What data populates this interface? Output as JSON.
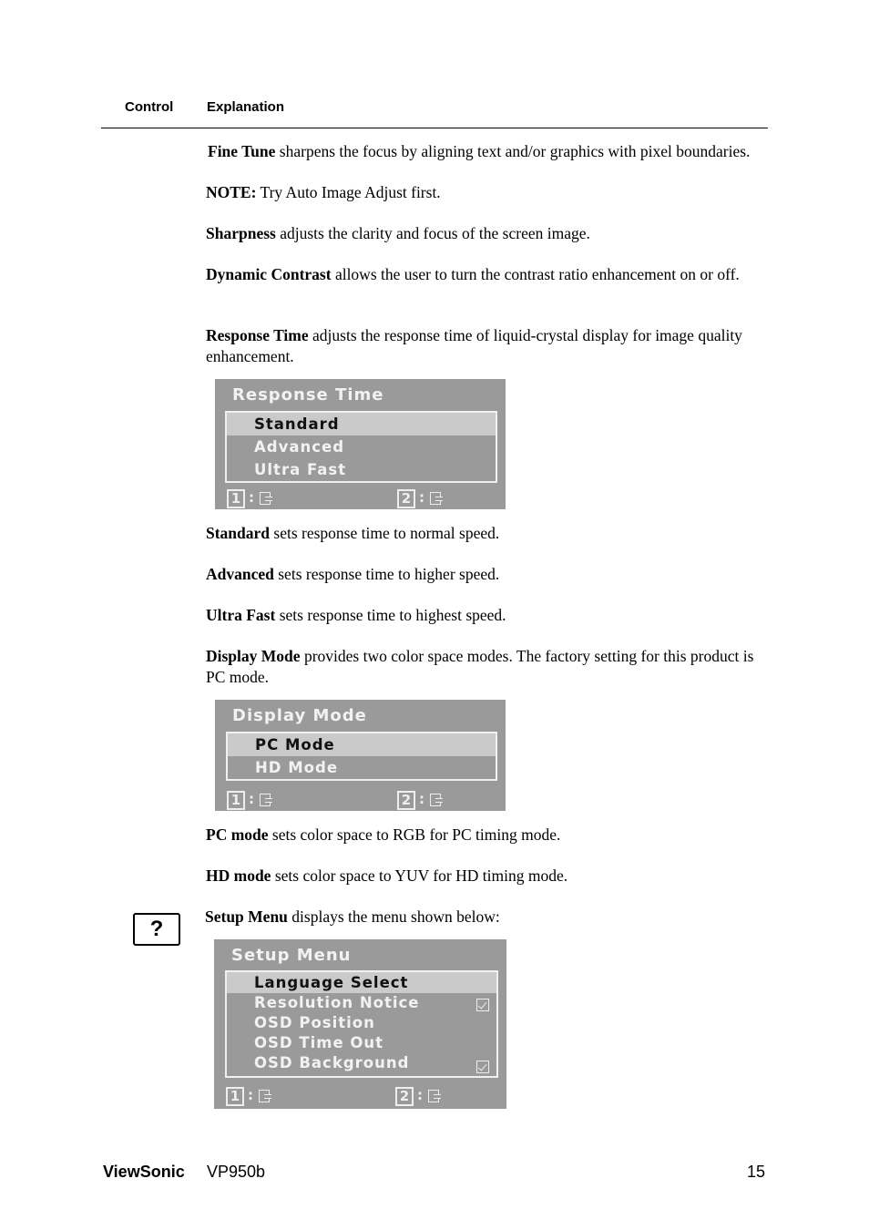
{
  "header": {
    "control": "Control",
    "explanation": "Explanation"
  },
  "paragraphs": {
    "fine_tune": {
      "term": "Fine Tune",
      "text": " sharpens the focus by aligning text and/or graphics with pixel boundaries."
    },
    "note": {
      "term": "NOTE:",
      "text": " Try Auto Image Adjust first."
    },
    "sharpness": {
      "term": "Sharpness",
      "text": " adjusts the clarity and focus of the screen image."
    },
    "dynamic_contrast": {
      "term": "Dynamic Contrast",
      "text": " allows the user to turn the contrast ratio enhancement on or off."
    },
    "response_time": {
      "term": "Response Time",
      "text": " adjusts the response time of liquid-crystal display for image quality enhancement."
    },
    "standard": {
      "term": "Standard",
      "text": " sets response time to normal speed."
    },
    "advanced": {
      "term": "Advanced",
      "text": " sets response time to higher speed."
    },
    "ultra_fast": {
      "term": "Ultra Fast",
      "text": " sets response time to highest speed."
    },
    "display_mode": {
      "term": "Display Mode",
      "text": " provides two color space modes. The factory setting for this product is PC mode."
    },
    "pc_mode": {
      "term": "PC mode",
      "text": " sets color space to RGB for PC timing mode."
    },
    "hd_mode": {
      "term": "HD mode",
      "text": " sets color space to YUV for HD timing mode."
    },
    "setup_menu": {
      "term": "Setup Menu",
      "text": " displays the menu shown below:"
    }
  },
  "osd_response_time": {
    "title": "Response Time",
    "items": [
      "Standard",
      "Advanced",
      "Ultra Fast"
    ],
    "selected": "Standard",
    "footer": {
      "key1": "1",
      "key2": "2",
      "sep": ":"
    }
  },
  "osd_display_mode": {
    "title": "Display Mode",
    "items": [
      "PC Mode",
      "HD Mode"
    ],
    "selected": "PC Mode",
    "footer": {
      "key1": "1",
      "key2": "2",
      "sep": ":"
    }
  },
  "osd_setup_menu": {
    "title": "Setup Menu",
    "items": [
      "Language Select",
      "Resolution Notice",
      "OSD Position",
      "OSD Time Out",
      "OSD Background"
    ],
    "selected": "Language Select",
    "checked": [
      "Resolution Notice",
      "OSD Background"
    ],
    "footer": {
      "key1": "1",
      "key2": "2",
      "sep": ":"
    }
  },
  "help_icon": {
    "glyph": "?"
  },
  "footer": {
    "brand": "ViewSonic",
    "model": "VP950b",
    "page": "15"
  }
}
